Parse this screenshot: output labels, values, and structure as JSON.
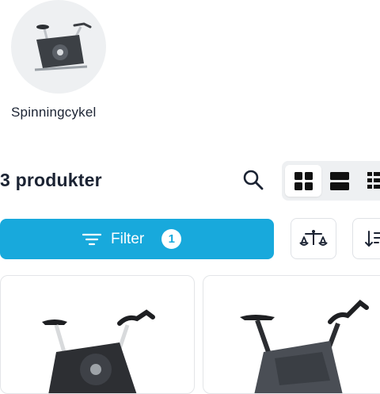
{
  "category": {
    "label": "Spinningcykel",
    "image_icon": "spinning-bike-image"
  },
  "results": {
    "count_label": "3 produkter"
  },
  "toolbar": {
    "search_icon": "search-icon",
    "view_options": [
      {
        "icon": "grid-view-icon",
        "active": true
      },
      {
        "icon": "list-view-icon",
        "active": false
      },
      {
        "icon": "compact-list-icon",
        "active": false
      }
    ],
    "filter": {
      "label": "Filter",
      "active_count": "1",
      "icon": "filter-lines-icon"
    },
    "compare_icon": "scale-compare-icon",
    "sort_icon": "sort-icon"
  },
  "products": [
    {
      "image_icon": "spinning-bike-image"
    },
    {
      "image_icon": "spinning-bike-image"
    }
  ],
  "colors": {
    "accent": "#18a9dc",
    "text": "#1b2333",
    "chip_bg": "#eef0f2",
    "border": "#dfe2e6"
  }
}
